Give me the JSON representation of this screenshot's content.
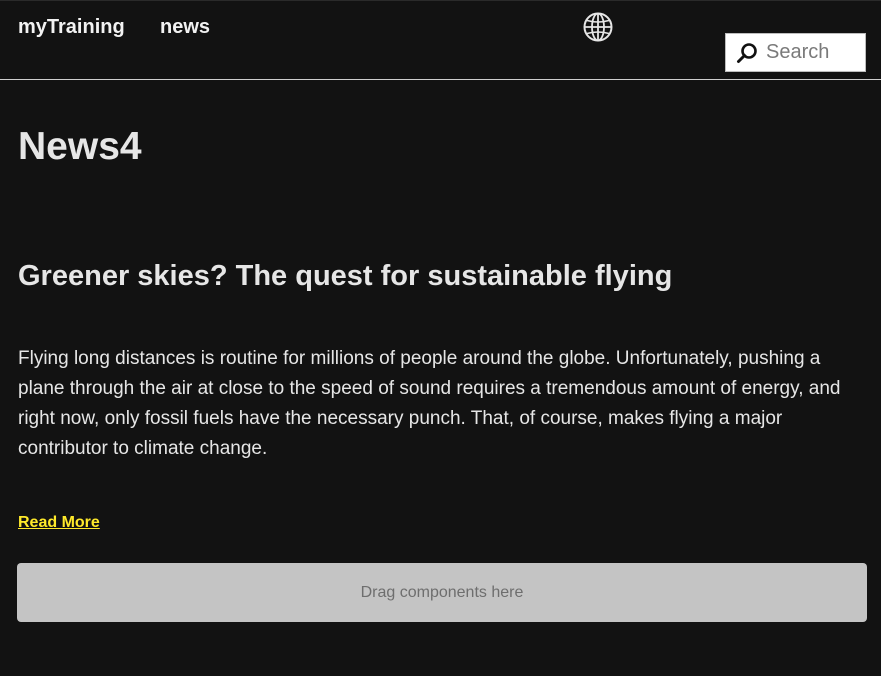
{
  "header": {
    "brand_label": "myTraining",
    "nav_news_label": "news",
    "language_icon": "globe-icon",
    "search": {
      "placeholder": "Search",
      "icon": "search-icon"
    }
  },
  "main": {
    "page_title": "News4",
    "article": {
      "title": "Greener skies? The quest for sustainable flying",
      "body": "Flying long distances is routine for millions of people around the globe. Unfortunately, pushing a plane through the air at close to the speed of sound requires a tremendous amount of energy, and right now, only fossil fuels have the necessary punch. That, of course, makes flying a major contributor to climate change.",
      "read_more_label": "Read More"
    },
    "dropzone_label": "Drag components here"
  },
  "colors": {
    "background": "#121212",
    "text": "#e6e6e6",
    "link_accent": "#ffea2a",
    "dropzone": "#c4c4c4"
  }
}
